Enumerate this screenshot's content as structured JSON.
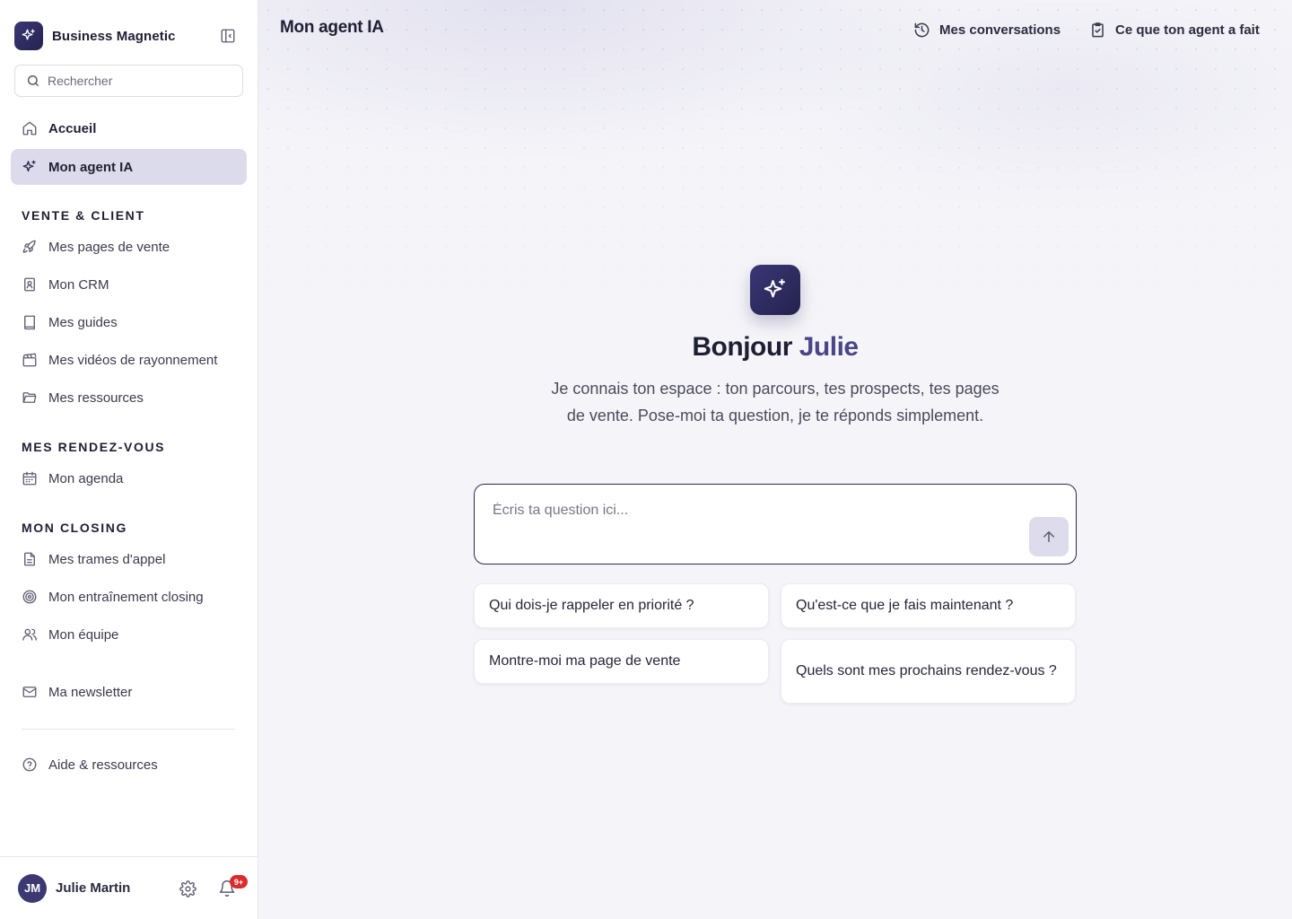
{
  "sidebar": {
    "brand": "Business Magnetic",
    "search_placeholder": "Rechercher",
    "top_items": [
      {
        "label": "Accueil",
        "icon": "home-icon"
      },
      {
        "label": "Mon agent IA",
        "icon": "sparkles-icon",
        "active": true
      }
    ],
    "sections": [
      {
        "title": "VENTE & CLIENT",
        "items": [
          {
            "label": "Mes pages de vente",
            "icon": "rocket-icon"
          },
          {
            "label": "Mon CRM",
            "icon": "contact-book-icon"
          },
          {
            "label": "Mes guides",
            "icon": "book-icon"
          },
          {
            "label": "Mes vidéos de rayonnement",
            "icon": "clapperboard-icon"
          },
          {
            "label": "Mes ressources",
            "icon": "folder-icon"
          }
        ]
      },
      {
        "title": "MES RENDEZ-VOUS",
        "items": [
          {
            "label": "Mon agenda",
            "icon": "calendar-icon"
          }
        ]
      },
      {
        "title": "MON CLOSING",
        "items": [
          {
            "label": "Mes trames d'appel",
            "icon": "file-text-icon"
          },
          {
            "label": "Mon entraînement closing",
            "icon": "target-icon"
          },
          {
            "label": "Mon équipe",
            "icon": "users-icon"
          }
        ]
      }
    ],
    "newsletter": {
      "label": "Ma newsletter",
      "icon": "mail-icon"
    },
    "help": {
      "label": "Aide & ressources",
      "icon": "help-circle-icon"
    },
    "user": {
      "initials": "JM",
      "name": "Julie Martin",
      "notifications": "9+"
    }
  },
  "header": {
    "title": "Mon agent IA",
    "conversations_label": "Mes conversations",
    "agent_log_label": "Ce que ton agent a fait"
  },
  "hero": {
    "greeting": "Bonjour",
    "name": "Julie",
    "subtitle": "Je connais ton espace : ton parcours, tes prospects, tes pages de vente. Pose-moi ta question, je te réponds simplement."
  },
  "composer": {
    "placeholder": "Écris ta question ici...",
    "value": ""
  },
  "suggestions": [
    "Qui dois-je rappeler en priorité ?",
    "Qu'est-ce que je fais maintenant ?",
    "Montre-moi ma page de vente",
    "Quels sont mes prochains rendez-vous ?"
  ],
  "colors": {
    "accent": "#2a2850",
    "accent_name": "#4a4688",
    "active_bg": "#dcdbec",
    "badge": "#d92d2d"
  }
}
